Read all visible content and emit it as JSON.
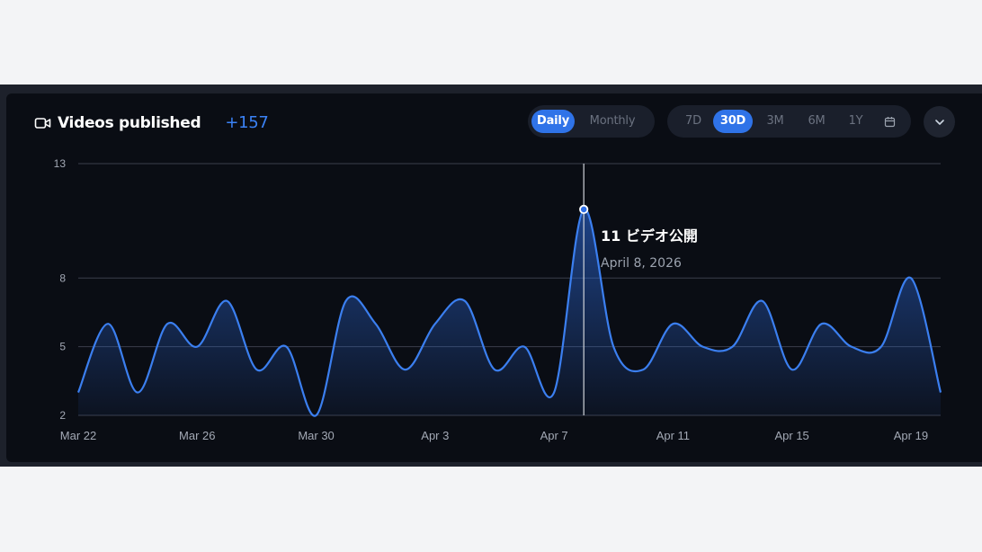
{
  "header": {
    "title": "Videos published",
    "delta": "+157",
    "icon": "video-camera-icon"
  },
  "granularity": {
    "options": [
      "Daily",
      "Monthly"
    ],
    "selected": "Daily"
  },
  "ranges": {
    "options": [
      "7D",
      "30D",
      "3M",
      "6M",
      "1Y"
    ],
    "selected": "30D",
    "calendar_icon": "calendar-icon"
  },
  "menu_icon": "chevron-down-icon",
  "tooltip": {
    "title": "11 ビデオ公開",
    "date": "April 8, 2026"
  },
  "colors": {
    "accent": "#3b82f6",
    "line": "#3b7ff0",
    "card_bg": "#0a0d14"
  },
  "chart_data": {
    "type": "area",
    "x": [
      "Mar 22",
      "Mar 23",
      "Mar 24",
      "Mar 25",
      "Mar 26",
      "Mar 27",
      "Mar 28",
      "Mar 29",
      "Mar 30",
      "Mar 31",
      "Apr 1",
      "Apr 2",
      "Apr 3",
      "Apr 4",
      "Apr 5",
      "Apr 6",
      "Apr 7",
      "Apr 8",
      "Apr 9",
      "Apr 10",
      "Apr 11",
      "Apr 12",
      "Apr 13",
      "Apr 14",
      "Apr 15",
      "Apr 16",
      "Apr 17",
      "Apr 18",
      "Apr 19",
      "Apr 20"
    ],
    "series": [
      {
        "values": [
          3,
          6,
          3,
          6,
          5,
          7,
          4,
          5,
          2,
          7,
          6,
          4,
          6,
          7,
          4,
          5,
          3,
          11,
          5,
          4,
          6,
          5,
          5,
          7,
          4,
          6,
          5,
          5,
          8,
          3
        ]
      }
    ],
    "x_tick_labels": [
      "Mar 22",
      "Mar 26",
      "Mar 30",
      "Apr 3",
      "Apr 7",
      "Apr 11",
      "Apr 15",
      "Apr 19"
    ],
    "y_ticks": [
      2,
      5,
      8,
      13
    ],
    "ylim": [
      2,
      13
    ],
    "highlighted_point": {
      "x": "Apr 8",
      "y": 11
    },
    "grid": true
  }
}
